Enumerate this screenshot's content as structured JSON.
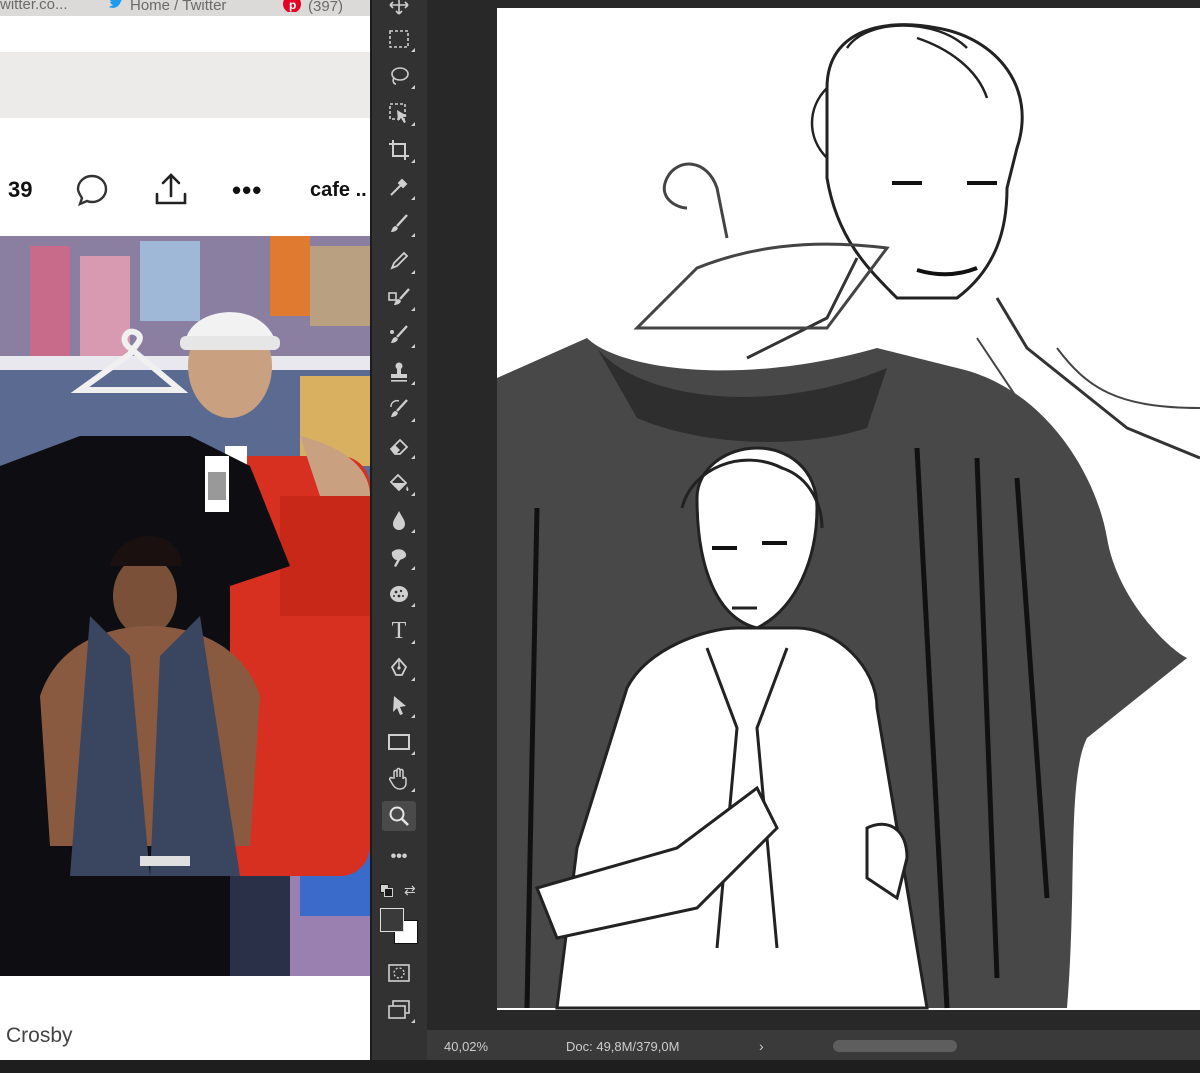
{
  "browser": {
    "tabs": [
      {
        "label": "witter.co...",
        "icon": "tab-favicon"
      },
      {
        "label": "Home / Twitter",
        "icon": "twitter-bird-icon"
      },
      {
        "label": "(397)",
        "icon": "pinterest-icon"
      }
    ],
    "tweet": {
      "reply_count": "39",
      "next_user": "cafe ..",
      "caption": "Crosby"
    }
  },
  "photoshop": {
    "tools": [
      "move-tool",
      "marquee-tool",
      "lasso-tool",
      "object-select-tool",
      "crop-tool",
      "eyedropper-tool",
      "brush-tool",
      "pencil-tool",
      "mixer-brush-tool",
      "color-replacement-tool",
      "clone-stamp-tool",
      "history-brush-tool",
      "eraser-tool",
      "paint-bucket-tool",
      "blur-tool",
      "smudge-tool",
      "sponge-tool",
      "type-tool",
      "pen-tool",
      "path-select-tool",
      "rectangle-tool",
      "hand-tool",
      "zoom-tool",
      "more-tools"
    ],
    "type_tool_glyph": "T",
    "more_glyph": "•••",
    "active_tool": "zoom-tool",
    "foreground_color": "#3a3a3a",
    "background_color": "#ffffff",
    "status": {
      "zoom": "40,02%",
      "doc_size": "Doc: 49,8M/379,0M",
      "chevron": "›"
    }
  },
  "colors": {
    "browser_bg": "#ffffff",
    "toolbar_bg": "#323232",
    "canvas_bg": "#282828"
  }
}
